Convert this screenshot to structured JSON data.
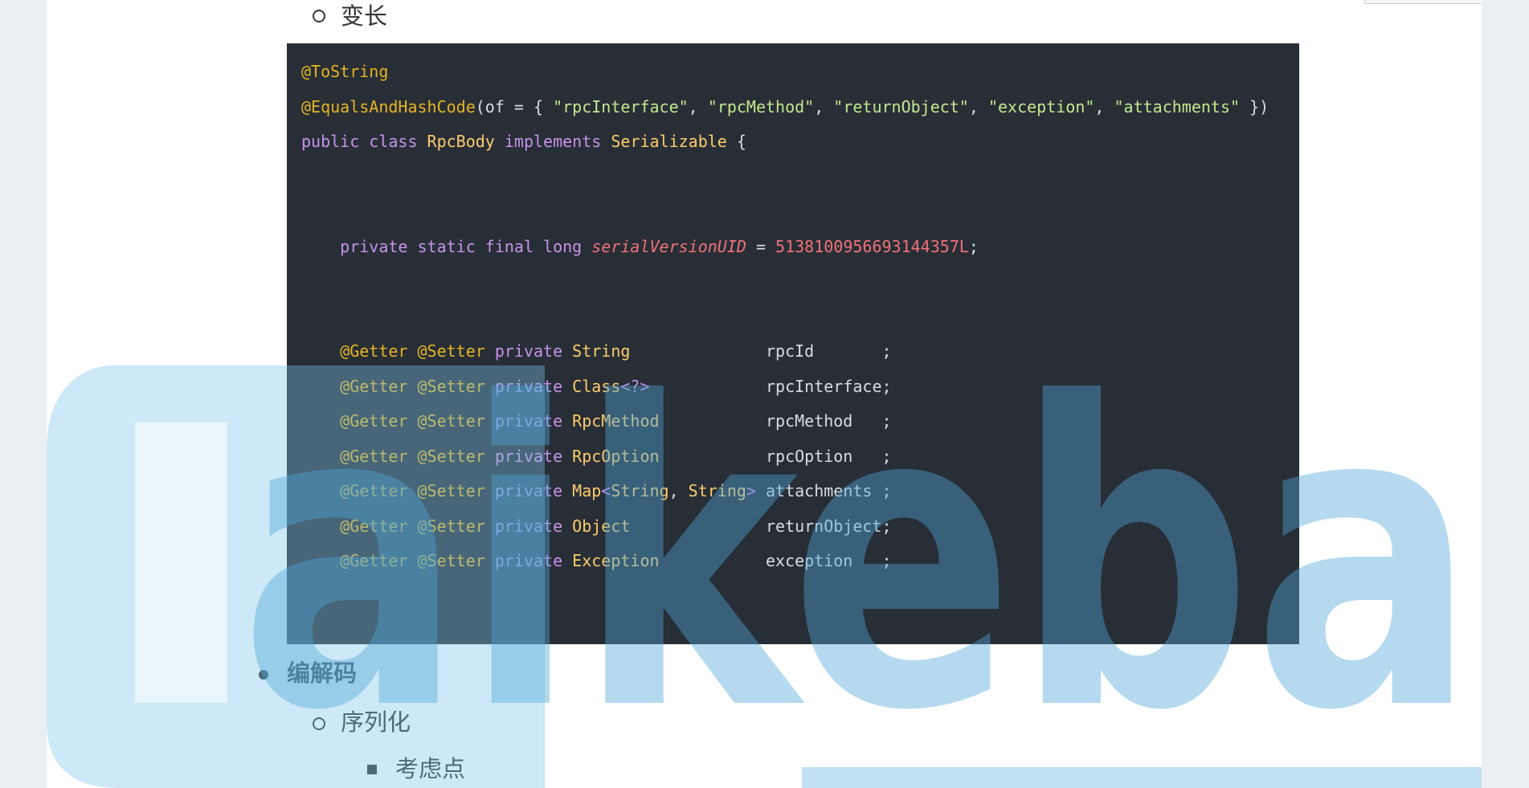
{
  "list": {
    "item_variable": "变长",
    "item_codec": "编解码",
    "item_serialize": "序列化",
    "item_considerations": "考虑点"
  },
  "code": {
    "lines": [
      {
        "segs": [
          {
            "c": "ann",
            "t": "@ToString"
          }
        ]
      },
      {
        "segs": [
          {
            "c": "ann",
            "t": "@EqualsAndHashCode"
          },
          {
            "c": "pl",
            "t": "(of = { "
          },
          {
            "c": "str",
            "t": "\"rpcInterface\""
          },
          {
            "c": "pl",
            "t": ", "
          },
          {
            "c": "str",
            "t": "\"rpcMethod\""
          },
          {
            "c": "pl",
            "t": ", "
          },
          {
            "c": "str",
            "t": "\"returnObject\""
          },
          {
            "c": "pl",
            "t": ", "
          },
          {
            "c": "str",
            "t": "\"exception\""
          },
          {
            "c": "pl",
            "t": ", "
          },
          {
            "c": "str",
            "t": "\"attachments\""
          },
          {
            "c": "pl",
            "t": " })"
          }
        ]
      },
      {
        "segs": [
          {
            "c": "kw",
            "t": "public class "
          },
          {
            "c": "ty",
            "t": "RpcBody "
          },
          {
            "c": "kw",
            "t": "implements "
          },
          {
            "c": "ty",
            "t": "Serializable "
          },
          {
            "c": "pl",
            "t": "{"
          }
        ]
      },
      {
        "segs": []
      },
      {
        "segs": []
      },
      {
        "segs": [
          {
            "c": "pl",
            "t": "    "
          },
          {
            "c": "kw",
            "t": "private static final long "
          },
          {
            "c": "it",
            "t": "serialVersionUID"
          },
          {
            "c": "pl",
            "t": " = "
          },
          {
            "c": "num",
            "t": "5138100956693144357L"
          },
          {
            "c": "pl",
            "t": ";"
          }
        ]
      },
      {
        "segs": []
      },
      {
        "segs": []
      },
      {
        "segs": [
          {
            "c": "pl",
            "t": "    "
          },
          {
            "c": "ann",
            "t": "@Getter @Setter "
          },
          {
            "c": "kw",
            "t": "private "
          },
          {
            "c": "ty",
            "t": "String"
          },
          {
            "c": "pl",
            "t": "              rpcId       ;"
          }
        ]
      },
      {
        "segs": [
          {
            "c": "pl",
            "t": "    "
          },
          {
            "c": "ann",
            "t": "@Getter @Setter "
          },
          {
            "c": "kw",
            "t": "private "
          },
          {
            "c": "ty",
            "t": "Class"
          },
          {
            "c": "kw",
            "t": "<?>"
          },
          {
            "c": "pl",
            "t": "            rpcInterface;"
          }
        ]
      },
      {
        "segs": [
          {
            "c": "pl",
            "t": "    "
          },
          {
            "c": "ann",
            "t": "@Getter @Setter "
          },
          {
            "c": "kw",
            "t": "private "
          },
          {
            "c": "ty",
            "t": "RpcMethod"
          },
          {
            "c": "pl",
            "t": "           rpcMethod   ;"
          }
        ]
      },
      {
        "segs": [
          {
            "c": "pl",
            "t": "    "
          },
          {
            "c": "ann",
            "t": "@Getter @Setter "
          },
          {
            "c": "kw",
            "t": "private "
          },
          {
            "c": "ty",
            "t": "RpcOption"
          },
          {
            "c": "pl",
            "t": "           rpcOption   ;"
          }
        ]
      },
      {
        "segs": [
          {
            "c": "pl",
            "t": "    "
          },
          {
            "c": "ann",
            "t": "@Getter @Setter "
          },
          {
            "c": "kw",
            "t": "private "
          },
          {
            "c": "ty",
            "t": "Map"
          },
          {
            "c": "kw",
            "t": "<"
          },
          {
            "c": "ty",
            "t": "String"
          },
          {
            "c": "pl",
            "t": ", "
          },
          {
            "c": "ty",
            "t": "String"
          },
          {
            "c": "kw",
            "t": ">"
          },
          {
            "c": "pl",
            "t": " attachments ;"
          }
        ]
      },
      {
        "segs": [
          {
            "c": "pl",
            "t": "    "
          },
          {
            "c": "ann",
            "t": "@Getter @Setter "
          },
          {
            "c": "kw",
            "t": "private "
          },
          {
            "c": "ty",
            "t": "Object"
          },
          {
            "c": "pl",
            "t": "              returnObject;"
          }
        ]
      },
      {
        "segs": [
          {
            "c": "pl",
            "t": "    "
          },
          {
            "c": "ann",
            "t": "@Getter @Setter "
          },
          {
            "c": "kw",
            "t": "private "
          },
          {
            "c": "ty",
            "t": "Exception"
          },
          {
            "c": "pl",
            "t": "           exception   ;"
          }
        ]
      },
      {
        "segs": []
      },
      {
        "segs": []
      },
      {
        "segs": [
          {
            "c": "pl",
            "t": "}"
          }
        ]
      }
    ]
  },
  "watermark_text": "Kaikeba"
}
